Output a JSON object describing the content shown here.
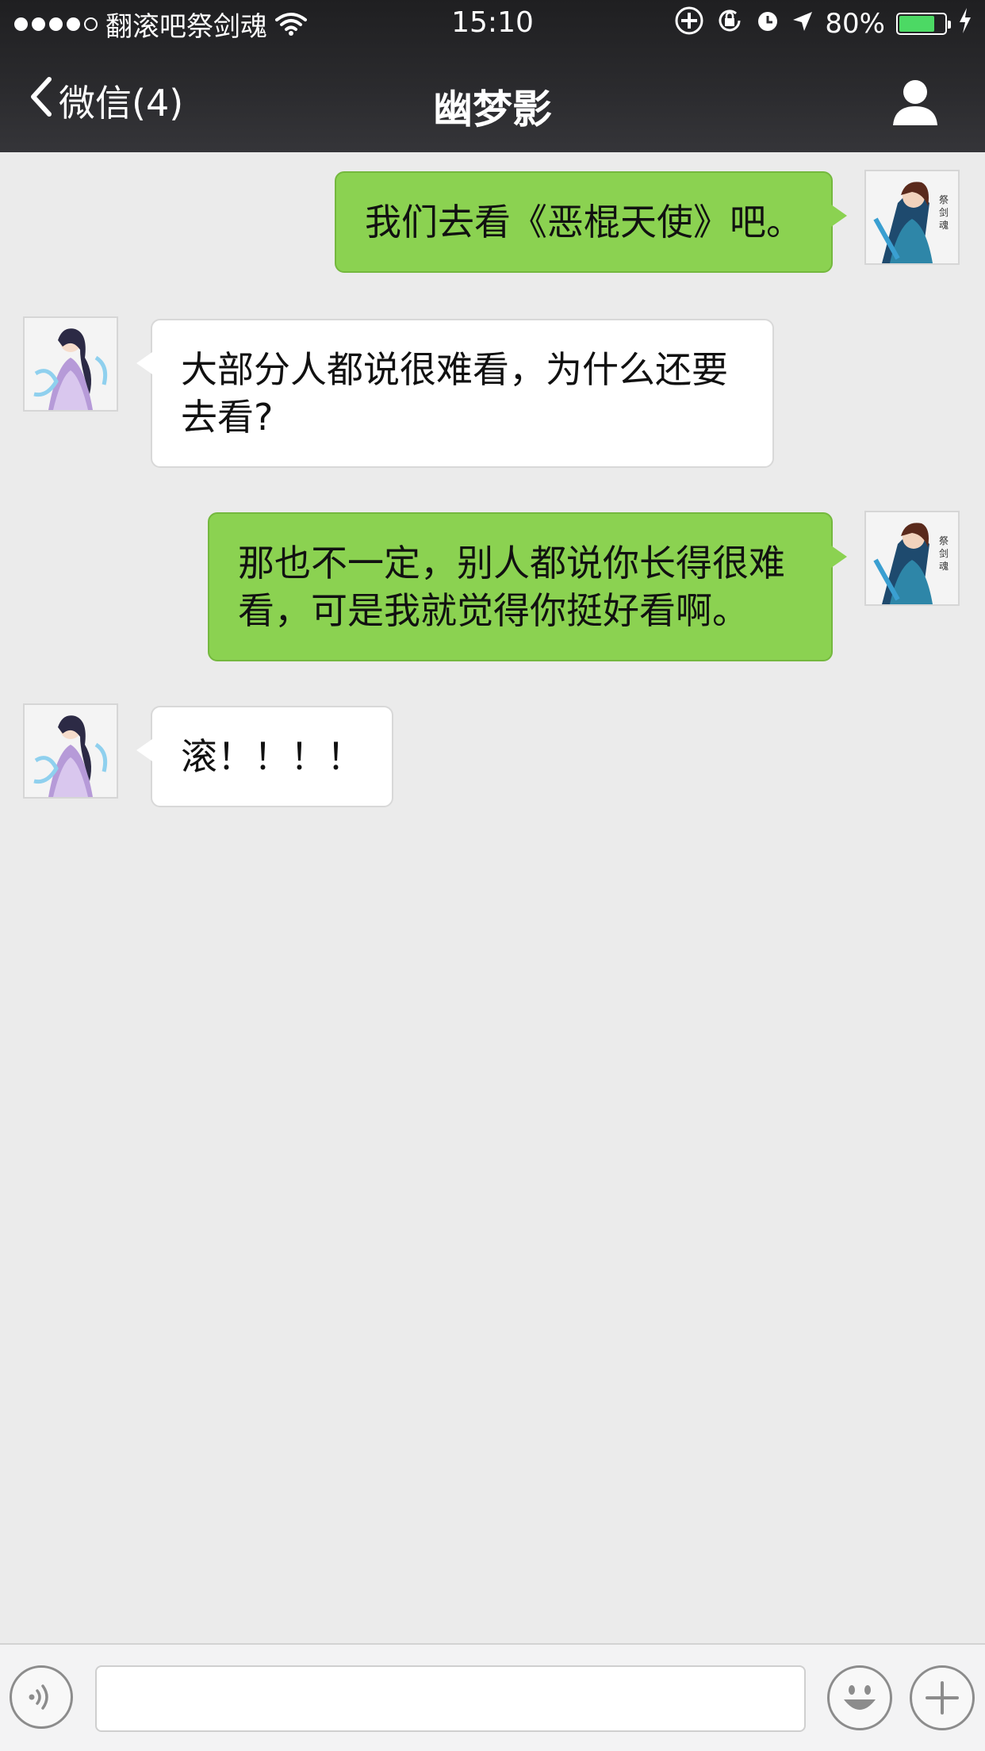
{
  "status_bar": {
    "carrier": "翻滚吧祭剑魂",
    "time": "15:10",
    "battery_text": "80%",
    "battery_level": 0.8,
    "icons": [
      "signal-dots",
      "wifi-icon",
      "rotation-lock-icon",
      "alarm-icon",
      "location-icon",
      "battery-icon",
      "charging-icon"
    ]
  },
  "nav": {
    "back_label": "微信(4)",
    "title": "幽梦影",
    "profile_icon": "person-icon"
  },
  "messages": [
    {
      "direction": "out",
      "text": "我们去看《恶棍天使》吧。"
    },
    {
      "direction": "in",
      "text": "大部分人都说很难看，为什么还要去看?"
    },
    {
      "direction": "out",
      "text": "那也不一定，别人都说你长得很难看，可是我就觉得你挺好看啊。"
    },
    {
      "direction": "in",
      "text": "滚！！！！"
    }
  ],
  "input_bar": {
    "text_value": "",
    "icons": [
      "voice-icon",
      "emoji-icon",
      "plus-icon"
    ]
  },
  "colors": {
    "outgoing_bubble": "#8bd251",
    "incoming_bubble": "#ffffff",
    "chat_background": "#ebebeb",
    "header": "#2b2b2e"
  }
}
